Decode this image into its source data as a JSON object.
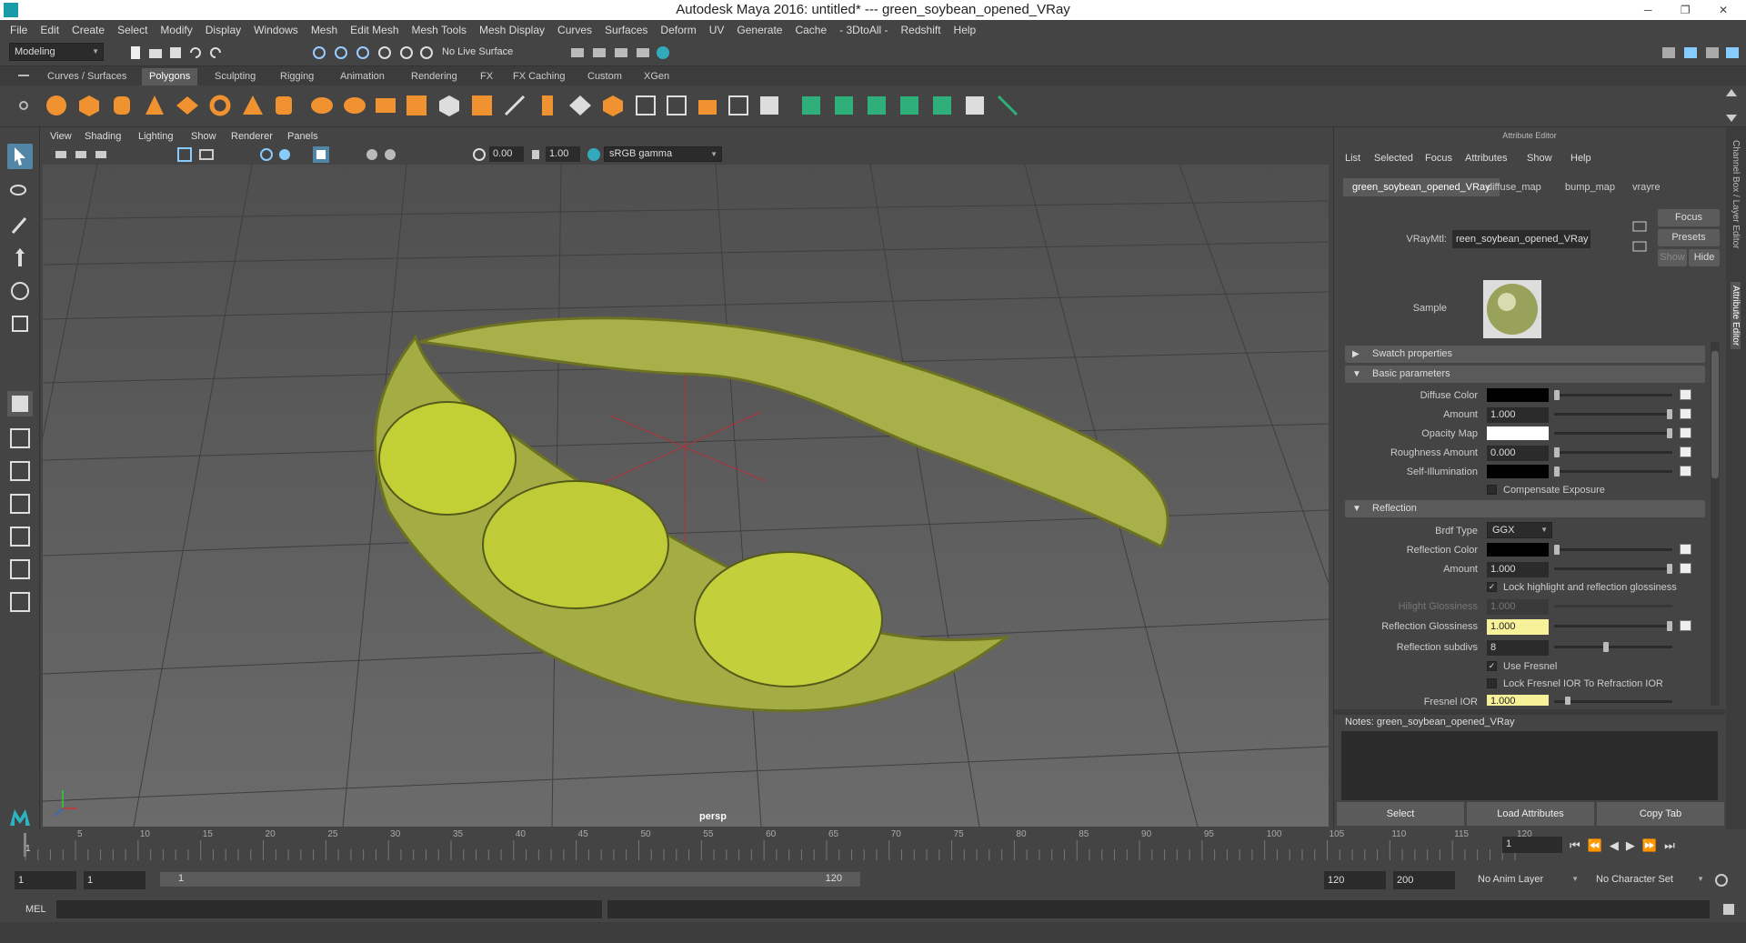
{
  "window": {
    "title": "Autodesk Maya 2016: untitled*   ---   green_soybean_opened_VRay"
  },
  "menubar": [
    "File",
    "Edit",
    "Create",
    "Select",
    "Modify",
    "Display",
    "Windows",
    "Mesh",
    "Edit Mesh",
    "Mesh Tools",
    "Mesh Display",
    "Curves",
    "Surfaces",
    "Deform",
    "UV",
    "Generate",
    "Cache",
    "- 3DtoAll -",
    "Redshift",
    "Help"
  ],
  "statusline": {
    "mode": "Modeling",
    "live_surface": "No Live Surface"
  },
  "shelf_tabs": [
    "Curves / Surfaces",
    "Polygons",
    "Sculpting",
    "Rigging",
    "Animation",
    "Rendering",
    "FX",
    "FX Caching",
    "Custom",
    "XGen"
  ],
  "shelf_active": "Polygons",
  "viewport": {
    "menus": [
      "View",
      "Shading",
      "Lighting",
      "Show",
      "Renderer",
      "Panels"
    ],
    "exposure": "0.00",
    "gamma": "1.00",
    "color_space": "sRGB gamma",
    "camera_label": "persp"
  },
  "attribute_editor": {
    "header": "Attribute Editor",
    "menus": [
      "List",
      "Selected",
      "Focus",
      "Attributes",
      "Show",
      "Help"
    ],
    "tabs": [
      "green_soybean_opened_VRay",
      "diffuse_map",
      "bump_map",
      "vrayre"
    ],
    "material_label": "VRayMtl:",
    "material_name": "reen_soybean_opened_VRay",
    "focus_btn": "Focus",
    "presets_btn": "Presets",
    "show_btn": "Show",
    "hide_btn": "Hide",
    "sample_label": "Sample",
    "sections": {
      "swatch": "Swatch properties",
      "basic": "Basic parameters",
      "reflection": "Reflection"
    },
    "basic": {
      "diffuse_color": "Diffuse Color",
      "amount_label": "Amount",
      "amount_value": "1.000",
      "opacity_map": "Opacity Map",
      "roughness_label": "Roughness Amount",
      "roughness_value": "0.000",
      "self_illum": "Self-Illumination",
      "compensate": "Compensate Exposure"
    },
    "reflection": {
      "brdf_label": "Brdf Type",
      "brdf_value": "GGX",
      "refl_color": "Reflection Color",
      "amount_label": "Amount",
      "amount_value": "1.000",
      "lock_hilight": "Lock highlight and reflection glossiness",
      "hilight_label": "Hilight Glossiness",
      "hilight_value": "1.000",
      "refl_gloss_label": "Reflection Glossiness",
      "refl_gloss_value": "1.000",
      "subdivs_label": "Reflection subdivs",
      "subdivs_value": "8",
      "use_fresnel": "Use Fresnel",
      "lock_fresnel": "Lock Fresnel IOR To Refraction IOR",
      "fresnel_label": "Fresnel IOR",
      "fresnel_value": "1.000"
    },
    "notes": "Notes:  green_soybean_opened_VRay",
    "buttons": [
      "Select",
      "Load Attributes",
      "Copy Tab"
    ]
  },
  "side_tabs": [
    "Channel Box / Layer Editor",
    "Attribute Editor"
  ],
  "timeline": {
    "ticks": [
      "5",
      "10",
      "15",
      "20",
      "25",
      "30",
      "35",
      "40",
      "45",
      "50",
      "55",
      "60",
      "65",
      "70",
      "75",
      "80",
      "85",
      "90",
      "95",
      "100",
      "105",
      "110",
      "115",
      "120"
    ],
    "start_marker": "1",
    "current_frame": "1"
  },
  "range": {
    "start": "1",
    "playback_start": "1",
    "slider_start": "1",
    "slider_end": "120",
    "playback_end": "120",
    "end": "200",
    "anim_layer": "No Anim Layer",
    "char_set": "No Character Set"
  },
  "command": {
    "label": "MEL"
  }
}
